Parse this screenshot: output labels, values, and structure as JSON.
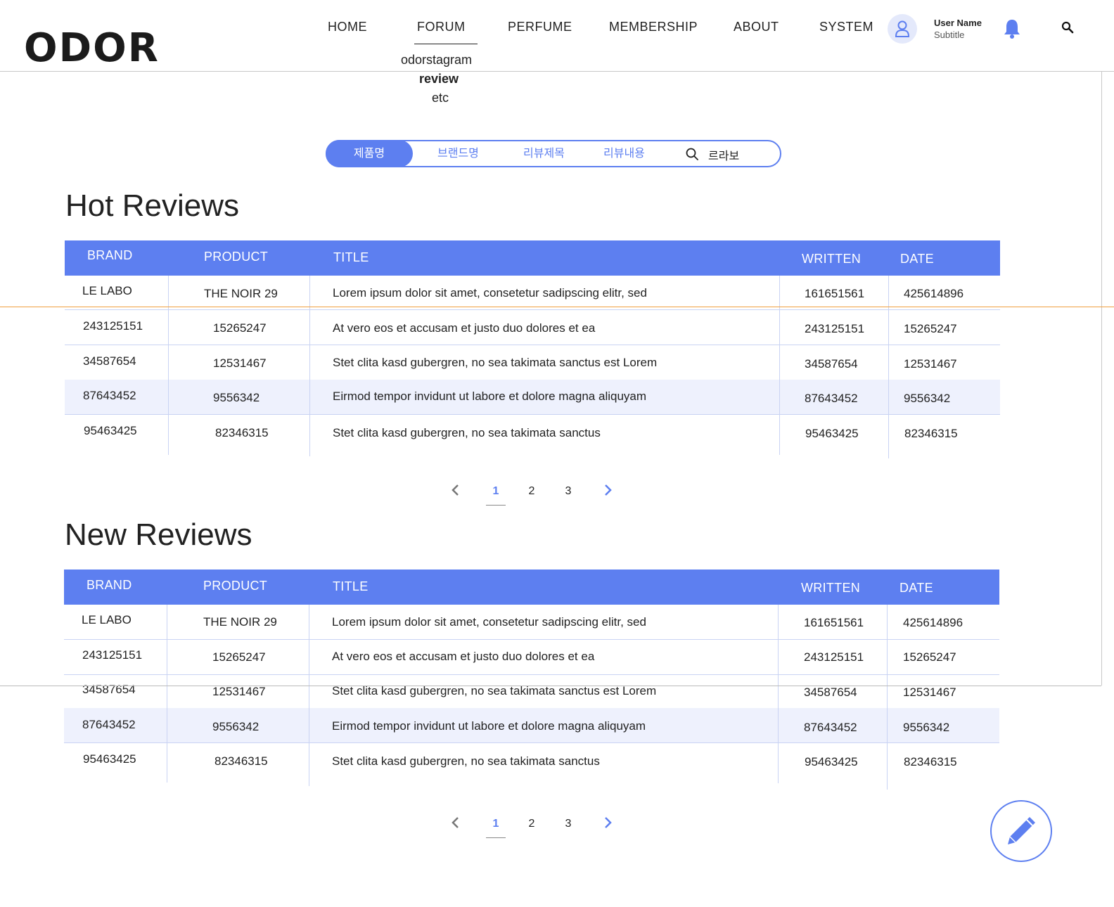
{
  "brand": {
    "logo": "ODOR"
  },
  "nav": {
    "items": [
      "HOME",
      "FORUM",
      "PERFUME",
      "MEMBERSHIP",
      "ABOUT",
      "SYSTEM"
    ],
    "active": "FORUM",
    "submenu": [
      "odorstagram",
      "review",
      "etc"
    ],
    "submenu_active": "review"
  },
  "user": {
    "name": "User Name",
    "subtitle": "Subtitle"
  },
  "icons": {
    "avatar": "user-icon",
    "notification": "bell-icon",
    "search": "search-icon",
    "write": "pencil-icon"
  },
  "colors": {
    "accent": "#5d7ff0",
    "row_shade": "#eef1fd",
    "border": "#c9d3f3"
  },
  "search": {
    "tabs": [
      "제품명",
      "브랜드명",
      "리뷰제목",
      "리뷰내용"
    ],
    "active_tab": "제품명",
    "value": "르라보"
  },
  "columns": [
    "BRAND",
    "PRODUCT",
    "TITLE",
    "WRITTEN",
    "DATE"
  ],
  "hot_reviews": {
    "title": "Hot Reviews",
    "rows": [
      [
        "LE LABO",
        "THE NOIR 29",
        "Lorem ipsum dolor sit amet, consetetur sadipscing elitr, sed",
        "161651561",
        "425614896"
      ],
      [
        "243125151",
        "15265247",
        "At vero eos et accusam et justo duo dolores et ea",
        "243125151",
        "15265247"
      ],
      [
        "34587654",
        "12531467",
        "Stet clita kasd gubergren, no sea takimata sanctus est Lorem",
        "34587654",
        "12531467"
      ],
      [
        "87643452",
        "9556342",
        "Eirmod tempor invidunt ut labore et dolore magna aliquyam",
        "87643452",
        "9556342"
      ],
      [
        "95463425",
        "82346315",
        "Stet clita kasd gubergren, no sea takimata sanctus",
        "95463425",
        "82346315"
      ]
    ],
    "pagination": {
      "pages": [
        "1",
        "2",
        "3"
      ],
      "current": "1"
    }
  },
  "new_reviews": {
    "title": "New Reviews",
    "rows": [
      [
        "LE LABO",
        "THE NOIR 29",
        "Lorem ipsum dolor sit amet, consetetur sadipscing elitr, sed",
        "161651561",
        "425614896"
      ],
      [
        "243125151",
        "15265247",
        "At vero eos et accusam et justo duo dolores et ea",
        "243125151",
        "15265247"
      ],
      [
        "34587654",
        "12531467",
        "Stet clita kasd gubergren, no sea takimata sanctus est Lorem",
        "34587654",
        "12531467"
      ],
      [
        "87643452",
        "9556342",
        "Eirmod tempor invidunt ut labore et dolore magna aliquyam",
        "87643452",
        "9556342"
      ],
      [
        "95463425",
        "82346315",
        "Stet clita kasd gubergren, no sea takimata sanctus",
        "95463425",
        "82346315"
      ]
    ],
    "pagination": {
      "pages": [
        "1",
        "2",
        "3"
      ],
      "current": "1"
    }
  }
}
